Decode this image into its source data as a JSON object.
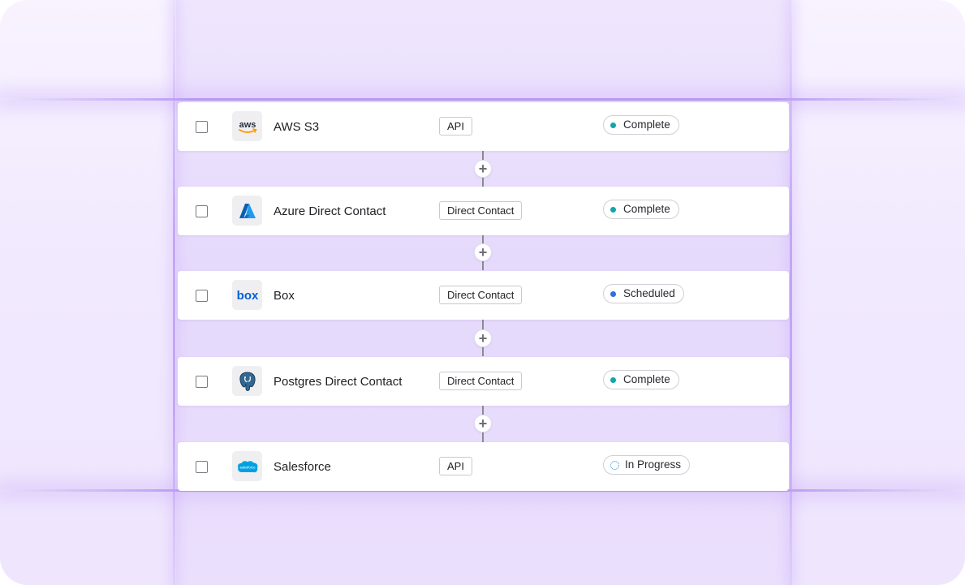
{
  "rows": [
    {
      "name": "AWS S3",
      "logo": "aws-logo",
      "tag": "API",
      "status": "Complete",
      "status_kind": "complete"
    },
    {
      "name": "Azure Direct Contact",
      "logo": "azure-logo",
      "tag": "Direct Contact",
      "status": "Complete",
      "status_kind": "complete"
    },
    {
      "name": "Box",
      "logo": "box-logo",
      "tag": "Direct Contact",
      "status": "Scheduled",
      "status_kind": "scheduled"
    },
    {
      "name": "Postgres Direct Contact",
      "logo": "postgres-logo",
      "tag": "Direct Contact",
      "status": "Complete",
      "status_kind": "complete"
    },
    {
      "name": "Salesforce",
      "logo": "salesforce-logo",
      "tag": "API",
      "status": "In Progress",
      "status_kind": "in-progress"
    }
  ],
  "logo_text": {
    "aws": "aws",
    "box": "box",
    "salesforce": "salesforce"
  },
  "add_button_symbol": "+",
  "colors": {
    "complete": "#12a5ad",
    "scheduled": "#2f6fe0",
    "in_progress": "#2a8fd8",
    "accent": "#b08cf0"
  }
}
